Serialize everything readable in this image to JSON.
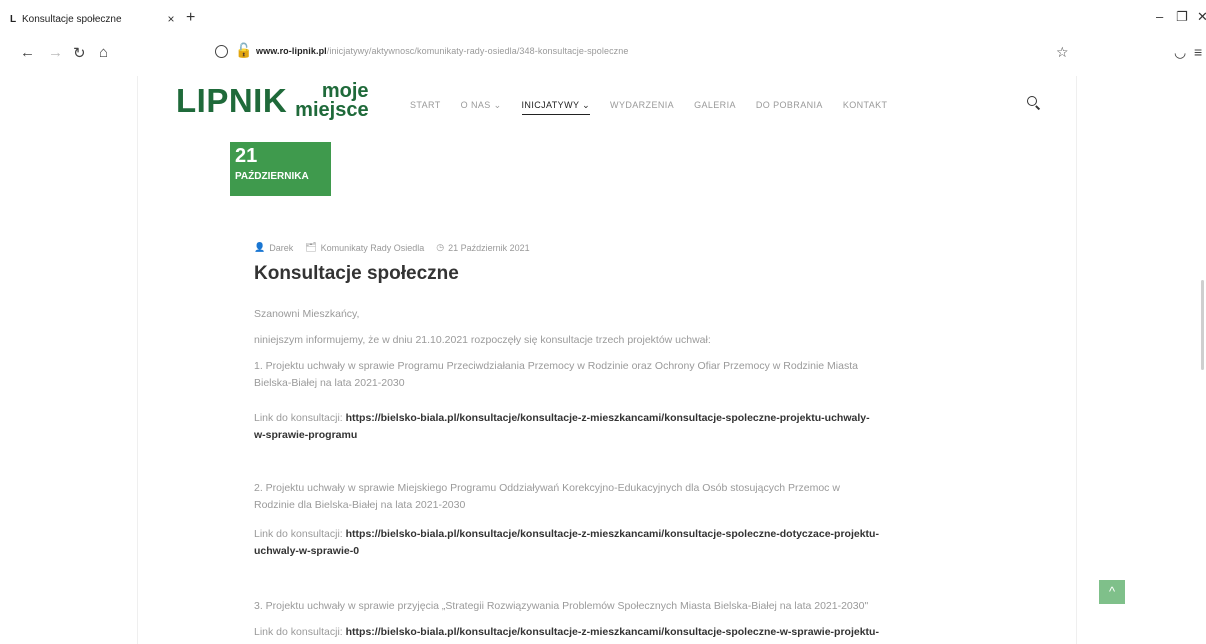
{
  "browser": {
    "tab_favicon": "L",
    "tab_title": "Konsultacje społeczne",
    "tab_close": "×",
    "new_tab": "+",
    "url_domain": "www.ro-lipnik.pl",
    "url_path": "/inicjatywy/aktywnosc/komunikaty-rady-osiedla/348-konsultacje-spoleczne",
    "icons": {
      "back": "back-arrow-icon",
      "forward": "forward-arrow-icon",
      "reload": "reload-icon",
      "home": "home-icon",
      "bookmark": "star-icon",
      "pocket": "pocket-icon",
      "menu": "menu-icon"
    }
  },
  "site": {
    "logo_main": "LIPNIK",
    "logo_sub_1": "moje",
    "logo_sub_2": "miejsce",
    "nav": [
      {
        "label": "START"
      },
      {
        "label": "O NAS ⌄"
      },
      {
        "label": "INICJATYWY ⌄",
        "active": true
      },
      {
        "label": "WYDARZENIA"
      },
      {
        "label": "GALERIA"
      },
      {
        "label": "DO POBRANIA"
      },
      {
        "label": "KONTAKT"
      }
    ],
    "accent_color": "#3f9a4d",
    "logo_color": "#1f6a3a"
  },
  "post": {
    "date_day": "21",
    "date_month": "PAŹDZIERNIKA",
    "author": "Darek",
    "category": "Komunikaty Rady Osiedla",
    "date": "21 Październik 2021",
    "title": "Konsultacje społeczne",
    "greeting": "Szanowni Mieszkańcy,",
    "intro": "niniejszym informujemy, że w dniu 21.10.2021 rozpoczęły się konsultacje trzech projektów uchwał:",
    "item1_line1": "1. Projektu uchwały w sprawie Programu Przeciwdziałania Przemocy w Rodzinie oraz Ochrony Ofiar Przemocy w Rodzinie Miasta",
    "item1_line2": "Bielska-Białej na lata 2021-2030",
    "link_label": "Link do konsultacji:",
    "link1_line1": "https://bielsko-biala.pl/konsultacje/konsultacje-z-mieszkancami/konsultacje-spoleczne-projektu-uchwaly-",
    "link1_line2": "w-sprawie-programu",
    "item2_line1": "2. Projektu uchwały w sprawie Miejskiego Programu Oddziaływań Korekcyjno-Edukacyjnych dla Osób stosujących Przemoc w",
    "item2_line2": "Rodzinie dla Bielska-Białej na lata 2021-2030",
    "link2_line1": "https://bielsko-biala.pl/konsultacje/konsultacje-z-mieszkancami/konsultacje-spoleczne-dotyczace-projektu-",
    "link2_line2": "uchwaly-w-sprawie-0",
    "item3_line1": "3. Projektu uchwały w sprawie przyjęcia „Strategii Rozwiązywania Problemów Społecznych Miasta Bielska-Białej na lata 2021-2030\"",
    "link3_line1": "https://bielsko-biala.pl/konsultacje/konsultacje-z-mieszkancami/konsultacje-spoleczne-w-sprawie-projektu-"
  }
}
